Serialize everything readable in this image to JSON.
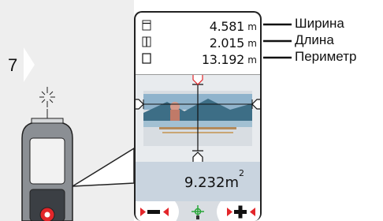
{
  "step": {
    "number": "7"
  },
  "screen": {
    "measurements": [
      {
        "icon": "width-icon",
        "value": "4.581",
        "unit": "m"
      },
      {
        "icon": "length-icon",
        "value": "2.015",
        "unit": "m"
      },
      {
        "icon": "perimeter-icon",
        "value": "13.192",
        "unit": "m"
      }
    ],
    "area": {
      "value": "9.232m",
      "exponent": "2"
    },
    "softkeys": [
      "minus-softkey-icon",
      "target-softkey-icon",
      "plus-softkey-icon"
    ]
  },
  "callouts": [
    "Ширина",
    "Длина",
    "Периметр"
  ],
  "colors": {
    "accent": "#e3262a",
    "camera_marker": "#2aa63a",
    "panel": "#c9d4df",
    "step_bar": "#eeeeee"
  }
}
